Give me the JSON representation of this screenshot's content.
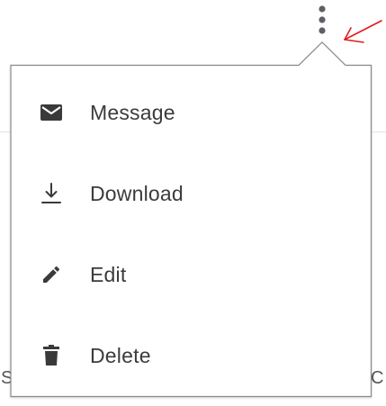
{
  "background": {
    "left_partial_text": "S",
    "right_partial_text": "C"
  },
  "menu": {
    "items": [
      {
        "label": "Message",
        "icon": "envelope-icon"
      },
      {
        "label": "Download",
        "icon": "download-icon"
      },
      {
        "label": "Edit",
        "icon": "pencil-icon"
      },
      {
        "label": "Delete",
        "icon": "trash-icon"
      }
    ]
  },
  "colors": {
    "icon": "#3a3a3a",
    "text": "#3b3b3b",
    "border": "#8a8a8a",
    "annotation": "#e21b1b",
    "kebab": "#5f5f66"
  }
}
